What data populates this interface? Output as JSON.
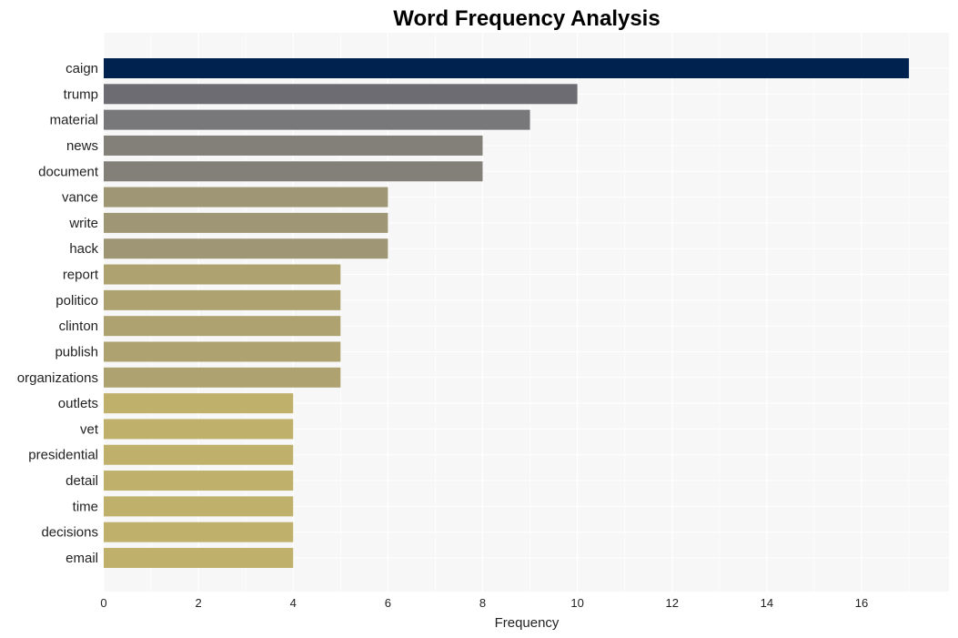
{
  "chart_data": {
    "type": "bar",
    "orientation": "horizontal",
    "title": "Word Frequency Analysis",
    "xlabel": "Frequency",
    "ylabel": "",
    "xlim": [
      0,
      17.8
    ],
    "xticks": [
      0,
      2,
      4,
      6,
      8,
      10,
      12,
      14,
      16
    ],
    "grid": true,
    "background": "#f7f7f7",
    "categories": [
      "caign",
      "trump",
      "material",
      "news",
      "document",
      "vance",
      "write",
      "hack",
      "report",
      "politico",
      "clinton",
      "publish",
      "organizations",
      "outlets",
      "vet",
      "presidential",
      "detail",
      "time",
      "decisions",
      "email"
    ],
    "values": [
      17,
      10,
      9,
      8,
      8,
      6,
      6,
      6,
      5,
      5,
      5,
      5,
      5,
      4,
      4,
      4,
      4,
      4,
      4,
      4
    ],
    "colors": [
      "#00224e",
      "#6c6c72",
      "#78787a",
      "#838079",
      "#838079",
      "#9f9675",
      "#9f9675",
      "#9f9675",
      "#aea370",
      "#aea370",
      "#aea370",
      "#aea370",
      "#aea370",
      "#bfb16c",
      "#bfb16c",
      "#bfb16c",
      "#bfb16c",
      "#bfb16c",
      "#bfb16c",
      "#bfb16c"
    ]
  }
}
